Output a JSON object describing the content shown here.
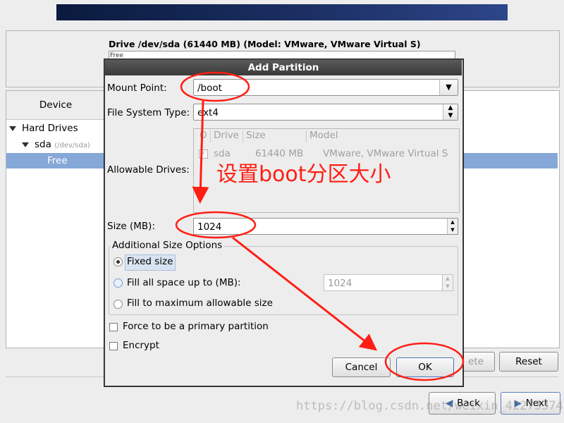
{
  "background": {
    "drive_title": "Drive /dev/sda (61440 MB) (Model: VMware, VMware Virtual S)",
    "drive_bar_label": "Free",
    "device_header": "Device",
    "tree": {
      "hard_drives": "Hard Drives",
      "sda": "sda",
      "sda_path": "(/dev/sda)",
      "free": "Free"
    },
    "delete_label": "ete",
    "reset_label": "Reset",
    "back_label": "Back",
    "next_label": "Next"
  },
  "dialog": {
    "title": "Add Partition",
    "mount_point_label": "Mount Point:",
    "mount_point_value": "/boot",
    "fs_type_label": "File System Type:",
    "fs_type_value": "ext4",
    "allowable_drives_label": "Allowable Drives:",
    "drives_table": {
      "columns": [
        "O",
        "Drive",
        "Size",
        "Model"
      ],
      "rows": [
        {
          "checked": true,
          "drive": "sda",
          "size": "61440 MB",
          "model": "VMware, VMware Virtual S"
        }
      ]
    },
    "size_label": "Size (MB):",
    "size_value": "1024",
    "additional_size_label": "Additional Size Options",
    "fixed_size_label": "Fixed size",
    "fill_space_label": "Fill all space up to (MB):",
    "fill_space_value": "1024",
    "fill_max_label": "Fill to maximum allowable size",
    "primary_label": "Force to be a primary partition",
    "encrypt_label": "Encrypt",
    "cancel_label": "Cancel",
    "ok_label": "OK"
  },
  "annotation": {
    "text": "设置boot分区大小",
    "color": "#ff1e14"
  },
  "watermark": "https://blog.csdn.net/weixin_42273374"
}
